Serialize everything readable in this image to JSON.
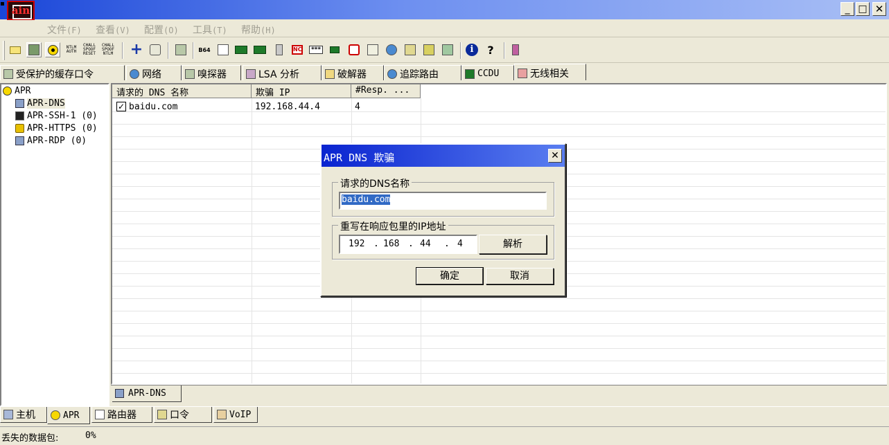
{
  "window": {
    "minimize": "_",
    "maximize": "□",
    "close": "✕",
    "app_logo_text": "ain",
    "corner_glyph": "▪"
  },
  "menu": [
    "文件",
    "(F)",
    "查看",
    "(V)",
    "配置",
    "(O)",
    "工具",
    "(T)",
    "帮助",
    "(H)"
  ],
  "toolbar": {
    "ntlm_icon_text": "NTLM AUTH",
    "chall_spoof_reset": "CHALL SPOOF RESET",
    "chall_spoof_ntlm": "CHALL SPOOF NTLM",
    "b64_icon_text": "B64",
    "passwords_icon_text": "***",
    "crack_icon_text": "NC"
  },
  "top_tabs": {
    "cached": "受保护的缓存口令",
    "network": "网络",
    "sniffer": "嗅探器",
    "lsa": "LSA 分析",
    "cracker": "破解器",
    "traceroute": "追踪路由",
    "ccdu": "CCDU",
    "wireless": "无线相关"
  },
  "tree": {
    "root": "APR",
    "items": [
      "APR-DNS",
      "APR-SSH-1 (0)",
      "APR-HTTPS (0)",
      "APR-RDP (0)"
    ]
  },
  "table": {
    "headers": [
      "请求的 DNS 名称",
      "欺骗 IP",
      "#Resp. ..."
    ],
    "rows": [
      {
        "checked": "✓",
        "name": "baidu.com",
        "ip": "192.168.44.4",
        "resp": "4"
      }
    ]
  },
  "sub_tab": "APR-DNS",
  "main_tabs": {
    "host": "主机",
    "apr": "APR",
    "router": "路由器",
    "password": "口令",
    "voip": "VoIP"
  },
  "status": {
    "label": "丢失的数据包:",
    "value": "0%"
  },
  "dialog": {
    "title": "APR DNS 欺骗",
    "close": "✕",
    "name_group": "请求的DNS名称",
    "name_value": "baidu.com",
    "ip_group": "重写在响应包里的IP地址",
    "ip": [
      "192",
      "168",
      "44",
      "4"
    ],
    "dot": ".",
    "resolve": "解析",
    "ok": "确定",
    "cancel": "取消"
  },
  "colors": {
    "titlebar": "#1a46d8",
    "dialog_title": "#0a24d0",
    "selection": "#316ac5",
    "face": "#ece9d8"
  }
}
